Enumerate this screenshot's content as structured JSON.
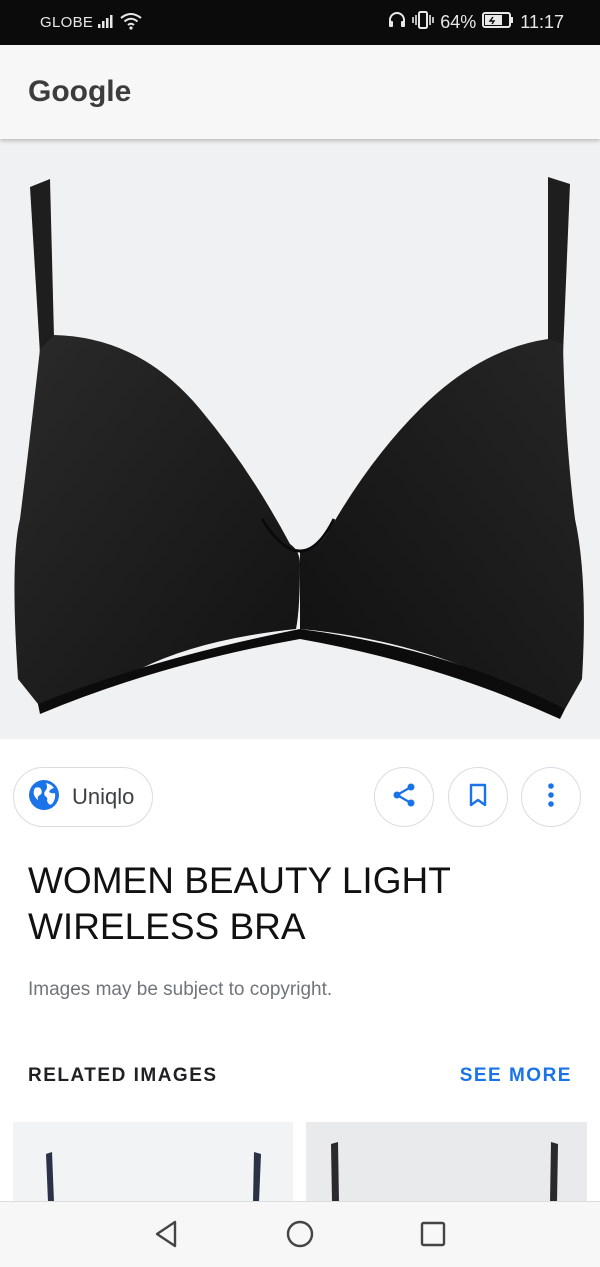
{
  "status_bar": {
    "carrier": "GLOBE",
    "battery_percent": "64%",
    "time": "11:17",
    "icons": [
      "signal-icon",
      "wifi-icon",
      "headphones-icon",
      "vibrate-icon",
      "battery-icon"
    ]
  },
  "app_bar": {
    "title": "Google"
  },
  "image": {
    "description_icon": "product-image",
    "background": "#f0f1f3"
  },
  "source": {
    "name": "Uniqlo",
    "icon": "globe-icon",
    "accent": "#1a73e8"
  },
  "actions": [
    {
      "name": "share",
      "icon": "share-icon"
    },
    {
      "name": "save",
      "icon": "bookmark-icon"
    },
    {
      "name": "more",
      "icon": "more-vert-icon"
    }
  ],
  "result": {
    "title": "WOMEN BEAUTY LIGHT WIRELESS BRA",
    "copyright": "Images may be subject to copyright."
  },
  "related": {
    "label": "RELATED IMAGES",
    "see_more": "SEE MORE"
  },
  "nav": {
    "back_icon": "back-triangle-icon",
    "home_icon": "home-circle-icon",
    "recent_icon": "recents-square-icon"
  }
}
